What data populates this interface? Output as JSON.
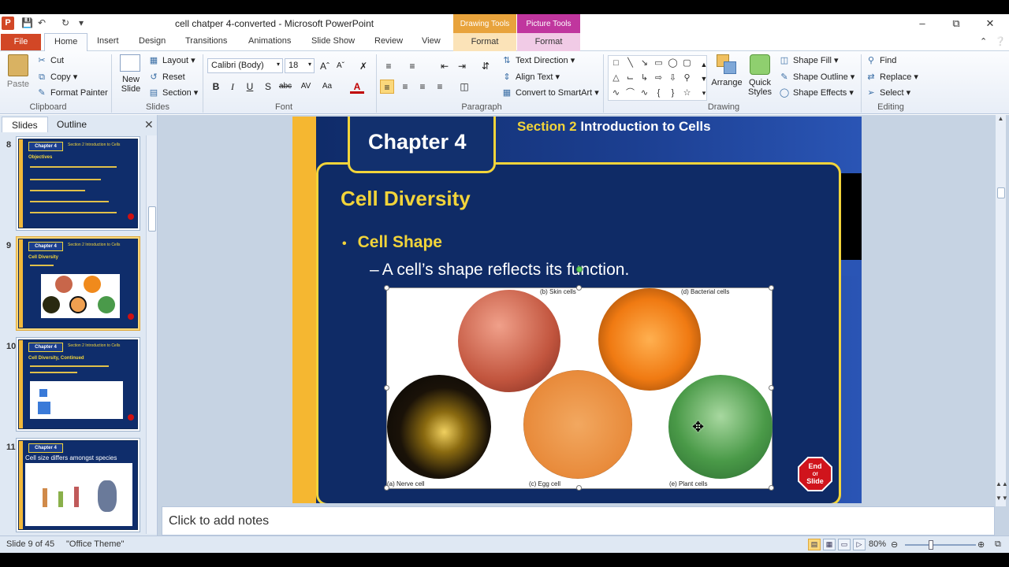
{
  "window": {
    "title": "cell chatper 4-converted  -  Microsoft PowerPoint",
    "context_tabs": [
      "Drawing Tools",
      "Picture Tools"
    ],
    "context_subtabs": [
      "Format",
      "Format"
    ]
  },
  "ribbon_tabs": [
    "File",
    "Home",
    "Insert",
    "Design",
    "Transitions",
    "Animations",
    "Slide Show",
    "Review",
    "View"
  ],
  "active_tab": "Home",
  "clipboard": {
    "paste": "Paste",
    "cut": "Cut",
    "copy": "Copy",
    "format_painter": "Format Painter",
    "label": "Clipboard"
  },
  "slides_group": {
    "new_slide": "New Slide",
    "layout": "Layout",
    "reset": "Reset",
    "section": "Section",
    "label": "Slides"
  },
  "font_group": {
    "font_name": "Calibri (Body)",
    "font_size": "18",
    "label": "Font"
  },
  "paragraph_group": {
    "text_direction": "Text Direction",
    "align_text": "Align Text",
    "convert_smartart": "Convert to SmartArt",
    "label": "Paragraph"
  },
  "drawing_group": {
    "arrange": "Arrange",
    "quick_styles": "Quick Styles",
    "shape_fill": "Shape Fill",
    "shape_outline": "Shape Outline",
    "shape_effects": "Shape Effects",
    "label": "Drawing"
  },
  "editing_group": {
    "find": "Find",
    "replace": "Replace",
    "select": "Select",
    "label": "Editing"
  },
  "side_pane": {
    "tabs": [
      "Slides",
      "Outline"
    ],
    "thumbnails": [
      {
        "number": "8",
        "heading": "Chapter 4",
        "subtitle": "Objectives"
      },
      {
        "number": "9",
        "heading": "Chapter 4",
        "subtitle": "Cell Diversity"
      },
      {
        "number": "10",
        "heading": "Chapter 4",
        "subtitle": "Cell Diversity, Continued"
      },
      {
        "number": "11",
        "heading": "Chapter 4",
        "subtitle": "Cell size differs amongst species"
      }
    ]
  },
  "slide": {
    "chapter": "Chapter 4",
    "section_number": "Section 2",
    "section_title": "Introduction  to Cells",
    "title": "Cell Diversity",
    "bullet_1": "Cell Shape",
    "bullet_2": "A cell’s shape reflects its function.",
    "captions": {
      "skin": "(b) Skin cells",
      "bacterial": "(d) Bacterial cells",
      "nerve": "(a) Nerve cell",
      "egg": "(c) Egg cell",
      "plant": "(e) Plant cells"
    },
    "end_slide": [
      "End",
      "Of",
      "Slide"
    ]
  },
  "notes": {
    "placeholder": "Click to add notes"
  },
  "status": {
    "slide_position": "Slide 9 of 45",
    "theme": "\"Office Theme\"",
    "zoom": "80%"
  }
}
